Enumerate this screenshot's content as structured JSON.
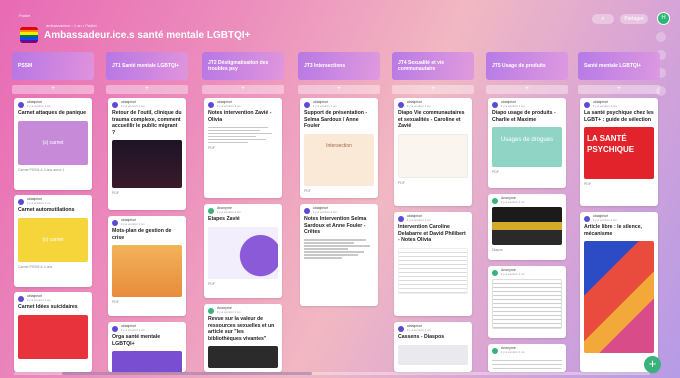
{
  "header": {
    "crumb": "Padlet",
    "crumb2": "ambassadeur • 1 an • Padlet",
    "title": "Ambassadeur.ice.s santé mentale LGBTQI+",
    "search_icon": "⌕",
    "share_label": "Partager",
    "avatar_initial": "H"
  },
  "columns": [
    {
      "title": "PSSM",
      "add": "+"
    },
    {
      "title": "JT1 Santé mentale LGBTQI+",
      "add": "+"
    },
    {
      "title": "JT2 Déstigmatisation des troubles psy",
      "add": "+"
    },
    {
      "title": "JT3 Intersections",
      "add": "+"
    },
    {
      "title": "JT4 Sexualité et vie communautaire",
      "add": "+"
    },
    {
      "title": "JT5 Usage de produits",
      "add": "+"
    },
    {
      "title": "Santé mentale LGBTQI+",
      "add": "+"
    }
  ],
  "cards": {
    "c1": {
      "author": "ubiaipriori",
      "time": "il y a environ 1 an",
      "title": "Carnet attaques de panique",
      "thumb": "(s) carnet",
      "caption": "Carnet PSSM & 4 ans anniv 1"
    },
    "c2": {
      "author": "ubiaipriori",
      "time": "il y a environ 1 an",
      "title": "Carnet automutilations",
      "thumb": "(s) carnet",
      "caption": "Carnet PSSM & 4 ans"
    },
    "c3": {
      "author": "ubiaipriori",
      "time": "il y a environ 1 an",
      "title": "Carnet Idées suicidaires",
      "thumb": "",
      "caption": ""
    },
    "c4": {
      "author": "ubiaipriori",
      "time": "il y a environ 1 an",
      "title": "Retour de l'outil, clinique du trauma complexe, comment accueillir le public migrant ?",
      "thumb": "",
      "caption": "PDF"
    },
    "c5": {
      "author": "ubiaipriori",
      "time": "il y a environ 1 an",
      "title": "Mots-plan de gestion de crise",
      "thumb": "",
      "caption": "PDF"
    },
    "c6": {
      "author": "ubiaipriori",
      "time": "il y a environ 1 an",
      "title": "Orga santé mentale LGBTQI+",
      "thumb": "",
      "caption": ""
    },
    "c7": {
      "author": "ubiaipriori",
      "time": "il y a environ 1 an",
      "title": "Notes intervention Zavié - Olivia",
      "thumb": "",
      "caption": "PDF"
    },
    "c8": {
      "author": "Anonyme",
      "time": "il y a environ 1 an",
      "title": "Etapes Zavié",
      "thumb": "",
      "caption": "PDF"
    },
    "c9": {
      "author": "Anonyme",
      "time": "il y a environ 1 an",
      "title": "Revue sur la valeur de ressources sexuelles et un article sur \"les bibliothèques vivantes\"",
      "thumb": "",
      "caption": ""
    },
    "c10": {
      "author": "ubiaipriori",
      "time": "il y a environ 1 an",
      "title": "Support de présentation - Selma Sardoux / Anne Fouler",
      "thumb": "Intersection",
      "caption": "PDF"
    },
    "c11": {
      "author": "ubiaipriori",
      "time": "il y a environ 1 an",
      "title": "Notes Intervention Selma Sardoux et Anne Fouler - Crêtes",
      "thumb": "",
      "caption": ""
    },
    "c12": {
      "author": "ubiaipriori",
      "time": "il y a environ 1 an",
      "title": "Diapo Vie communautaires et sexualités - Caroline et Zavié",
      "thumb": "",
      "caption": "PDF"
    },
    "c13": {
      "author": "ubiaipriori",
      "time": "il y a environ 1 an",
      "title": "Intervention Caroline Delabarre et David Philibert - Notes Olivia",
      "thumb": "",
      "caption": ""
    },
    "c14": {
      "author": "ubiaipriori",
      "time": "il y a environ 1 an",
      "title": "Cassens - Diaspos",
      "thumb": "",
      "caption": ""
    },
    "c15": {
      "author": "ubiaipriori",
      "time": "il y a environ 1 an",
      "title": "Diapo usage de produits - Charlie et Maxime",
      "thumb": "Usages de drogues",
      "caption": "PDF"
    },
    "c16": {
      "author": "Anonyme",
      "time": "il y a environ 1 an",
      "title": "",
      "thumb": "",
      "caption": "Diapos"
    },
    "c17": {
      "author": "Anonyme",
      "time": "il y a environ 1 an",
      "title": "",
      "thumb": "",
      "caption": ""
    },
    "c18": {
      "author": "Anonyme",
      "time": "il y a environ 1 an",
      "title": "",
      "thumb": "",
      "caption": ""
    },
    "c19": {
      "author": "ubiaipriori",
      "time": "il y a environ 1 an",
      "title": "La santé psychique chez les LGBT+ : guide de sélection",
      "thumb": "LA SANTÉ PSYCHIQUE",
      "caption": "PDF"
    },
    "c20": {
      "author": "ubiaipriori",
      "time": "il y a environ 1 an",
      "title": "Article libre : le silence, mécanisme",
      "thumb": "",
      "caption": ""
    }
  },
  "colors": {
    "accent": "#b276e8",
    "fab": "#39b27c",
    "avatar": "#2bb673"
  }
}
